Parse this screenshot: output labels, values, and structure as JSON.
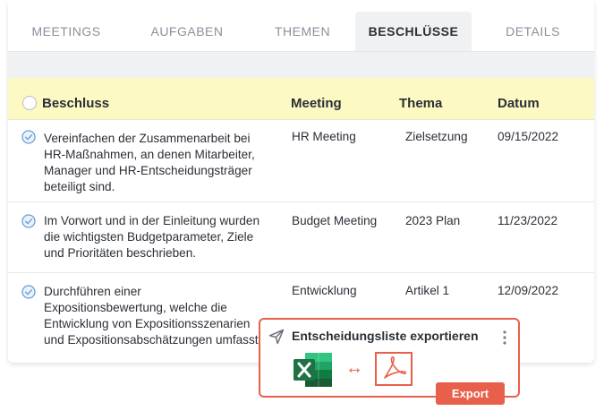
{
  "tabs": [
    {
      "label": "MEETINGS"
    },
    {
      "label": "AUFGABEN"
    },
    {
      "label": "THEMEN"
    },
    {
      "label": "BESCHLÜSSE",
      "active": true
    },
    {
      "label": "DETAILS"
    }
  ],
  "table": {
    "headers": {
      "beschluss": "Beschluss",
      "meeting": "Meeting",
      "thema": "Thema",
      "datum": "Datum"
    },
    "rows": [
      {
        "lines": [
          "Vereinfachen der Zusammenarbeit bei",
          "HR-Maßnahmen, an denen Mitarbeiter,",
          "Manager und HR-Entscheidungsträger",
          "beteiligt sind."
        ],
        "meeting": "HR Meeting",
        "thema": "Zielsetzung",
        "datum": "09/15/2022"
      },
      {
        "lines": [
          "Im Vorwort und in der Einleitung wurden",
          "die wichtigsten Budgetparameter, Ziele",
          "und Prioritäten beschrieben."
        ],
        "meeting": "Budget Meeting",
        "thema": "2023 Plan",
        "datum": "11/23/2022"
      },
      {
        "lines": [
          "Durchführen einer",
          "Expositionsbewertung, welche die",
          "Entwicklung von Expositionsszenarien",
          "und Expositionsabschätzungen umfasst."
        ],
        "meeting": "Entwicklung",
        "thema": "Artikel 1",
        "datum": "12/09/2022"
      }
    ]
  },
  "export_popup": {
    "title": "Entscheidungsliste exportieren",
    "button_label": "Export",
    "icons": [
      "send-icon",
      "more-vertical-icon",
      "excel-icon",
      "swap-arrow-icon",
      "pdf-icon"
    ],
    "arrow_glyph": "↔"
  },
  "colors": {
    "header_bg": "#fdf9c2",
    "accent": "#e8604c",
    "check": "#6b9fd6",
    "excel_green": "#1f7244"
  }
}
